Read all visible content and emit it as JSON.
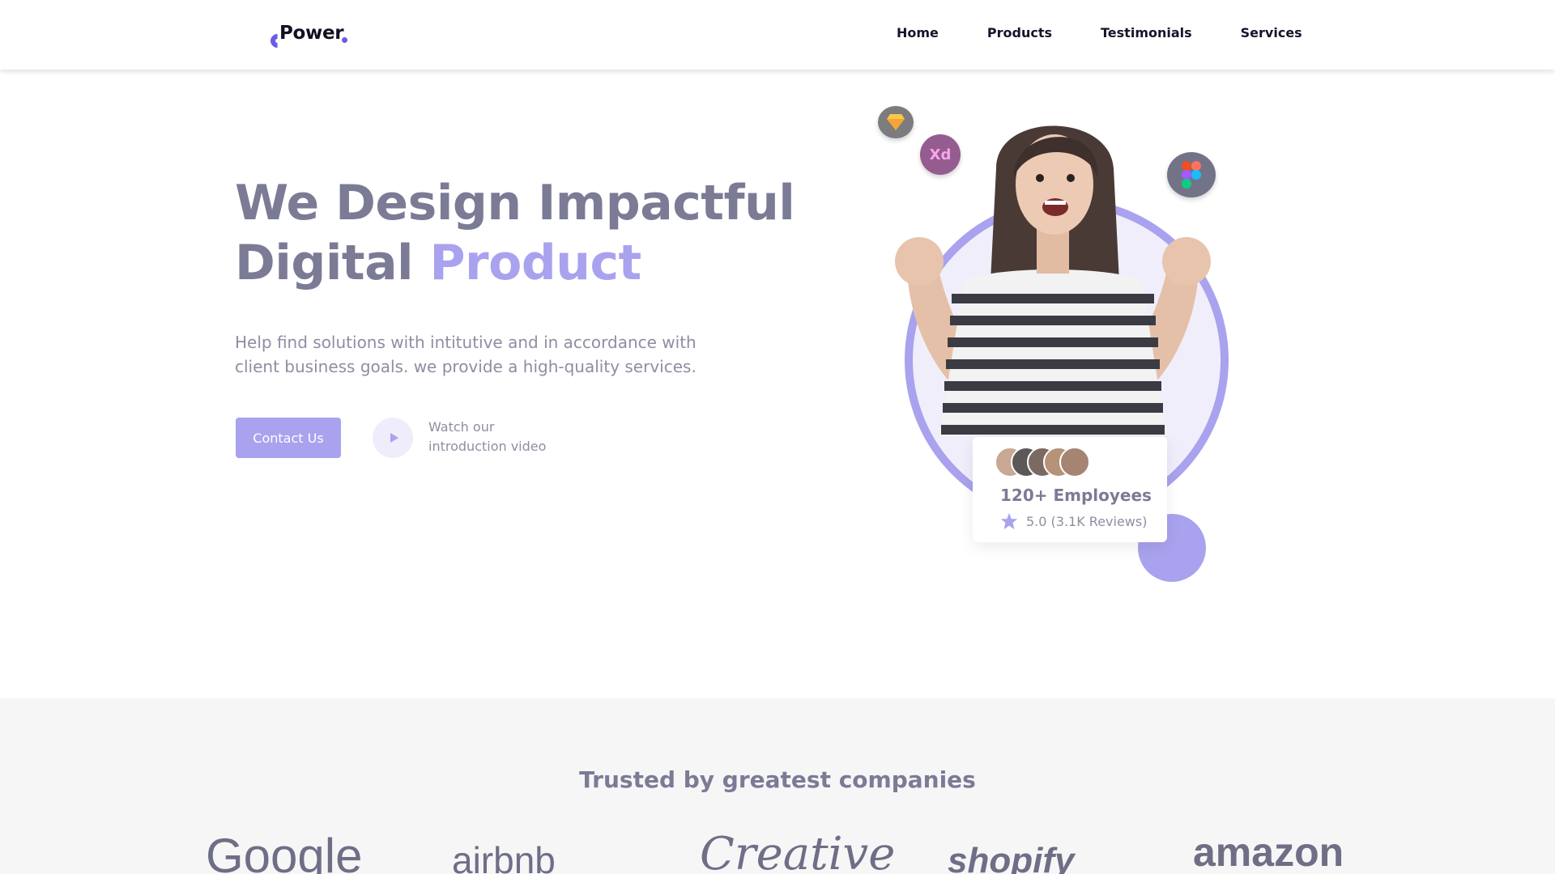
{
  "brand": {
    "name": "Power",
    "accent": "#6b5be6"
  },
  "nav": {
    "items": [
      "Home",
      "Products",
      "Testimonials",
      "Services"
    ]
  },
  "hero": {
    "title_line1": "We Design Impactful",
    "title_line2_a": "Digital",
    "title_line2_b": "Product",
    "subtitle_line1": "Help find solutions with intitutive and in accordance with",
    "subtitle_line2": "client business goals. we provide a high-quality services.",
    "cta_label": "Contact Us",
    "watch_line1": "Watch our",
    "watch_line2": "introduction video"
  },
  "illustration": {
    "badges": [
      "sketch-icon",
      "adobe-xd-icon",
      "figma-icon"
    ],
    "xd_label": "Xd"
  },
  "employees_card": {
    "title": "120+ Employees",
    "rating": "5.0 (3.1K Reviews)"
  },
  "trusted": {
    "title": "Trusted by greatest companies",
    "logos": [
      "Google",
      "airbnb",
      "Creative",
      "shopify",
      "amazon"
    ]
  },
  "colors": {
    "primary_muted": "#a9a2ee",
    "heading_muted": "#7b7b96",
    "text_muted": "#8e8ea2",
    "section_bg": "#f6f6f7"
  }
}
